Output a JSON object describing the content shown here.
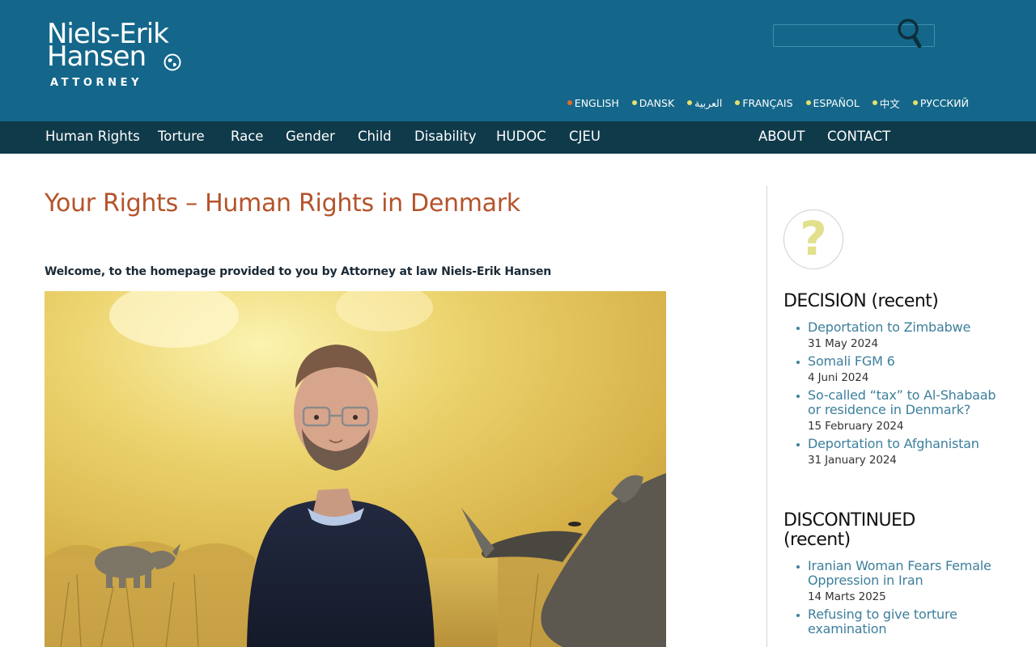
{
  "header": {
    "logo": {
      "line1": "Niels-Erik",
      "line2": "Hansen",
      "line3": "ATTORNEY"
    },
    "search": {
      "placeholder": "",
      "value": "",
      "icon": "search-icon"
    },
    "languages": [
      {
        "label": "ENGLISH",
        "active": true
      },
      {
        "label": "DANSK",
        "active": false
      },
      {
        "label": "العربية",
        "active": false
      },
      {
        "label": "FRANÇAIS",
        "active": false
      },
      {
        "label": "ESPAÑOL",
        "active": false
      },
      {
        "label": "中文",
        "active": false
      },
      {
        "label": "РУССКИЙ",
        "active": false
      }
    ]
  },
  "nav": {
    "left": [
      "Human Rights",
      "Torture",
      "Race",
      "Gender",
      "Child",
      "Disability",
      "HUDOC",
      "CJEU"
    ],
    "right": [
      "ABOUT",
      "CONTACT"
    ]
  },
  "main": {
    "title": "Your Rights – Human Rights in Denmark",
    "welcome": "Welcome, to the homepage provided to you by Attorney at law Niels-Erik Hansen"
  },
  "sidebar": {
    "icon": "question-mark-icon",
    "icon_glyph": "?",
    "sections": [
      {
        "heading": "DECISION (recent)",
        "items": [
          {
            "title": "Deportation to Zimbabwe",
            "date": "31 May 2024"
          },
          {
            "title": "Somali FGM 6",
            "date": "4 Juni 2024"
          },
          {
            "title": "So-called “tax” to Al-Shabaab or residence in Denmark?",
            "date": "15 February 2024"
          },
          {
            "title": "Deportation to Afghanistan",
            "date": "31 January 2024"
          }
        ]
      },
      {
        "heading": "DISCONTINUED (recent)",
        "items": [
          {
            "title": "Iranian Woman Fears Female Oppression in Iran",
            "date": "14 Marts 2025"
          },
          {
            "title": "Refusing to give torture examination",
            "date": ""
          }
        ]
      }
    ]
  },
  "colors": {
    "header_bg": "#14678a",
    "nav_bg": "#0f3a4a",
    "title_color": "#b5532b",
    "link_color": "#3d7f9c",
    "lang_dot": "#e8e06a",
    "lang_dot_active": "#e8692a"
  }
}
